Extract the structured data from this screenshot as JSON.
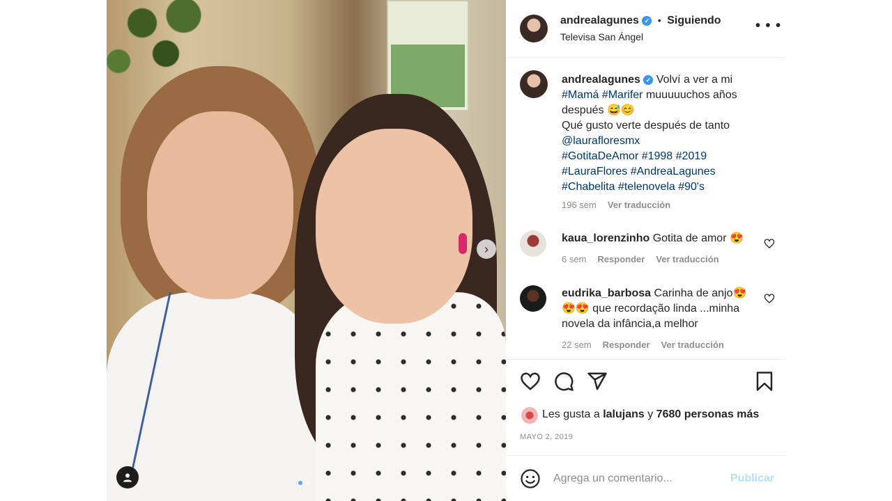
{
  "post": {
    "username": "andrealagunes",
    "follow_status": "Siguiendo",
    "dot": "•",
    "location": "Televisa San Ángel",
    "more_icon": "more-horizontal-icon",
    "verified_icon": "verified-badge-icon",
    "verified_glyph": "✓"
  },
  "photo": {
    "next_glyph": "›",
    "carousel": {
      "count": 2,
      "active_index": 0
    },
    "tag_icon": "user-tag-icon"
  },
  "caption": {
    "username": "andrealagunes",
    "line1_text": "Volví a ver a mi",
    "line2_tag1": "#Mamá",
    "line2_tag2": "#Marifer",
    "line2_text": "muuuuuchos años",
    "line3_text": "después",
    "line3_emoji": "😅😊",
    "line4_text": "Qué gusto verte después de tanto",
    "line5_mention": "@laurafloresmx",
    "line6_tags": "#GotitaDeAmor #1998 #2019",
    "line7_tags": "#LauraFlores #AndreaLagunes",
    "line8_tags": "#Chabelita #telenovela #90's",
    "time": "196 sem",
    "translate": "Ver traducción"
  },
  "comments": [
    {
      "username": "kaua_lorenzinho",
      "text": "Gotita de amor",
      "emoji": "😍",
      "time": "6 sem",
      "reply": "Responder",
      "translate": "Ver traducción"
    },
    {
      "username": "eudrika_barbosa",
      "text_line1": "Carinha de anjo",
      "emoji_line1": "😍",
      "emoji_line2": "😍😍",
      "text_line2": "que recordação linda ...minha",
      "text_line3": "novela da infância,a melhor",
      "time": "22 sem",
      "reply": "Responder",
      "translate": "Ver traducción"
    }
  ],
  "actions": {
    "icons": [
      "heart-icon",
      "comment-icon",
      "share-icon",
      "bookmark-icon"
    ]
  },
  "likes": {
    "prefix": "Les gusta a",
    "user": "lalujans",
    "joiner": "y",
    "others": "7680 personas más"
  },
  "date": "MAYO 2, 2019",
  "composer": {
    "placeholder": "Agrega un comentario...",
    "publish": "Publicar",
    "emoji_icon": "emoji-smile-icon"
  },
  "colors": {
    "verified": "#3897f0",
    "link": "#00376b",
    "muted": "#8e8e8e",
    "publish_disabled": "#b2dffc",
    "carousel_active": "#5ba8f5"
  }
}
